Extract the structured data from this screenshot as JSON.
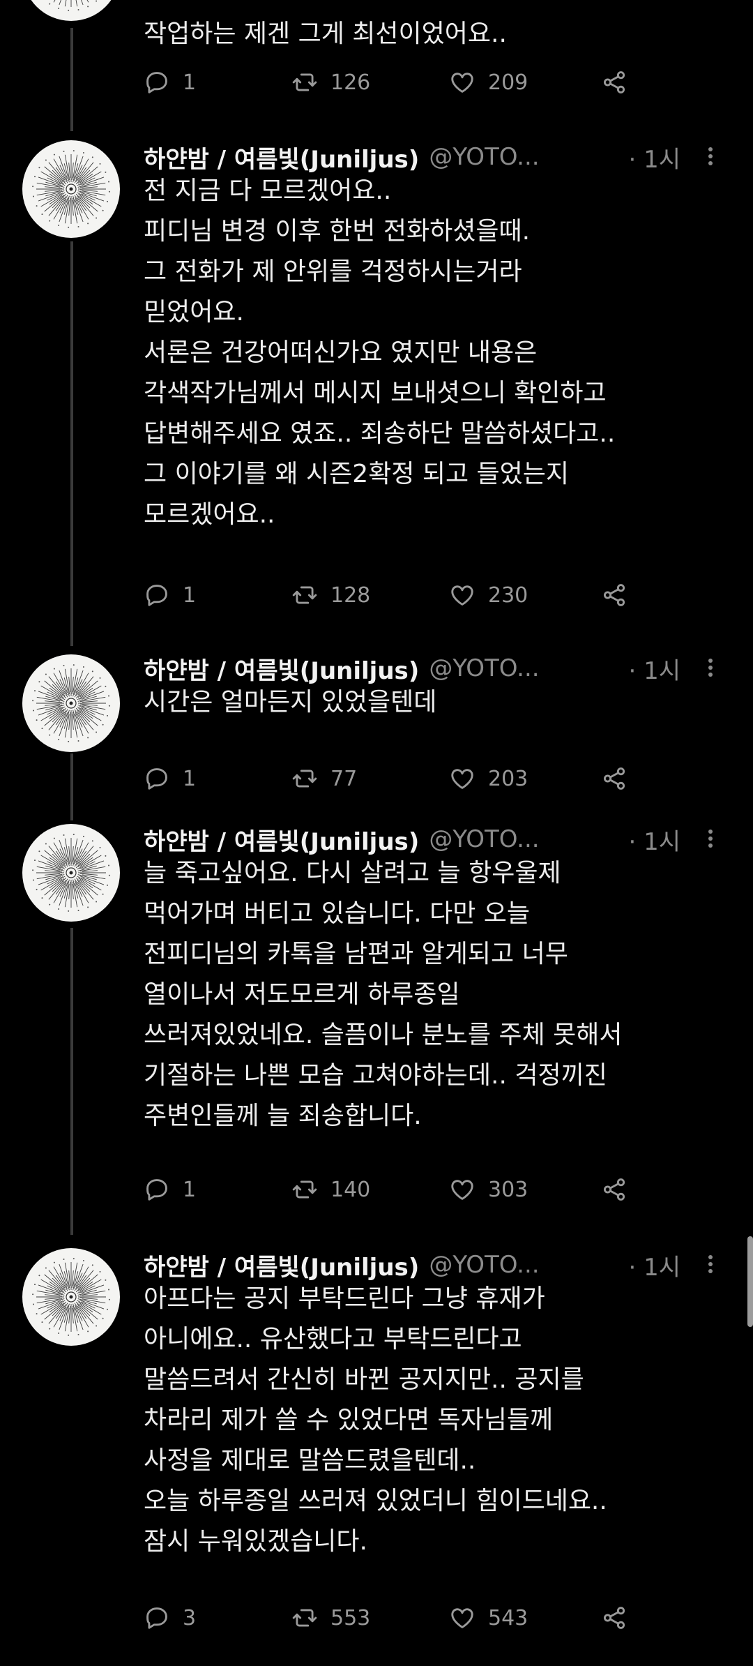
{
  "tweets": [
    {
      "name": "",
      "handle": "",
      "time": "",
      "lines": [
        "작업하는 제겐 그게 최선이었어요.."
      ],
      "replies": "1",
      "retweets": "126",
      "likes": "209"
    },
    {
      "name": "하얀밤 / 여름빛(Juniljus)",
      "handle": "@YOTO...",
      "time": "· 1시",
      "lines": [
        "전 지금 다 모르겠어요..",
        "피디님 변경 이후 한번 전화하셨을때.",
        "그 전화가 제 안위를 걱정하시는거라",
        "믿었어요.",
        "서론은 건강어떠신가요 였지만 내용은",
        "각색작가님께서 메시지 보내셧으니 확인하고",
        "답변해주세요 였죠.. 죄송하단 말씀하셨다고..",
        "그 이야기를 왜 시즌2확정 되고 들었는지",
        "모르겠어요.."
      ],
      "replies": "1",
      "retweets": "128",
      "likes": "230"
    },
    {
      "name": "하얀밤 / 여름빛(Juniljus)",
      "handle": "@YOTO...",
      "time": "· 1시",
      "lines": [
        "시간은 얼마든지 있었을텐데"
      ],
      "replies": "1",
      "retweets": "77",
      "likes": "203"
    },
    {
      "name": "하얀밤 / 여름빛(Juniljus)",
      "handle": "@YOTO...",
      "time": "· 1시",
      "lines": [
        "늘 죽고싶어요. 다시 살려고 늘 항우울제",
        "먹어가며 버티고 있습니다. 다만 오늘",
        "전피디님의 카톡을 남편과 알게되고 너무",
        "열이나서 저도모르게 하루종일",
        "쓰러져있었네요. 슬픔이나 분노를 주체 못해서",
        "기절하는 나쁜 모습 고쳐야하는데.. 걱정끼진",
        "주변인들께 늘 죄송합니다."
      ],
      "replies": "1",
      "retweets": "140",
      "likes": "303"
    },
    {
      "name": "하얀밤 / 여름빛(Juniljus)",
      "handle": "@YOTO...",
      "time": "· 1시",
      "lines": [
        "아프다는 공지 부탁드린다 그냥 휴재가",
        "아니에요.. 유산했다고 부탁드린다고",
        "말씀드려서 간신히 바뀐 공지지만.. 공지를",
        "차라리 제가 쓸 수 있었다면 독자님들께",
        "사정을 제대로 말씀드렸을텐데..",
        "오늘 하루종일 쓰러져 있었더니 힘이드네요..",
        "잠시 누워있겠습니다."
      ],
      "replies": "3",
      "retweets": "553",
      "likes": "543"
    }
  ]
}
